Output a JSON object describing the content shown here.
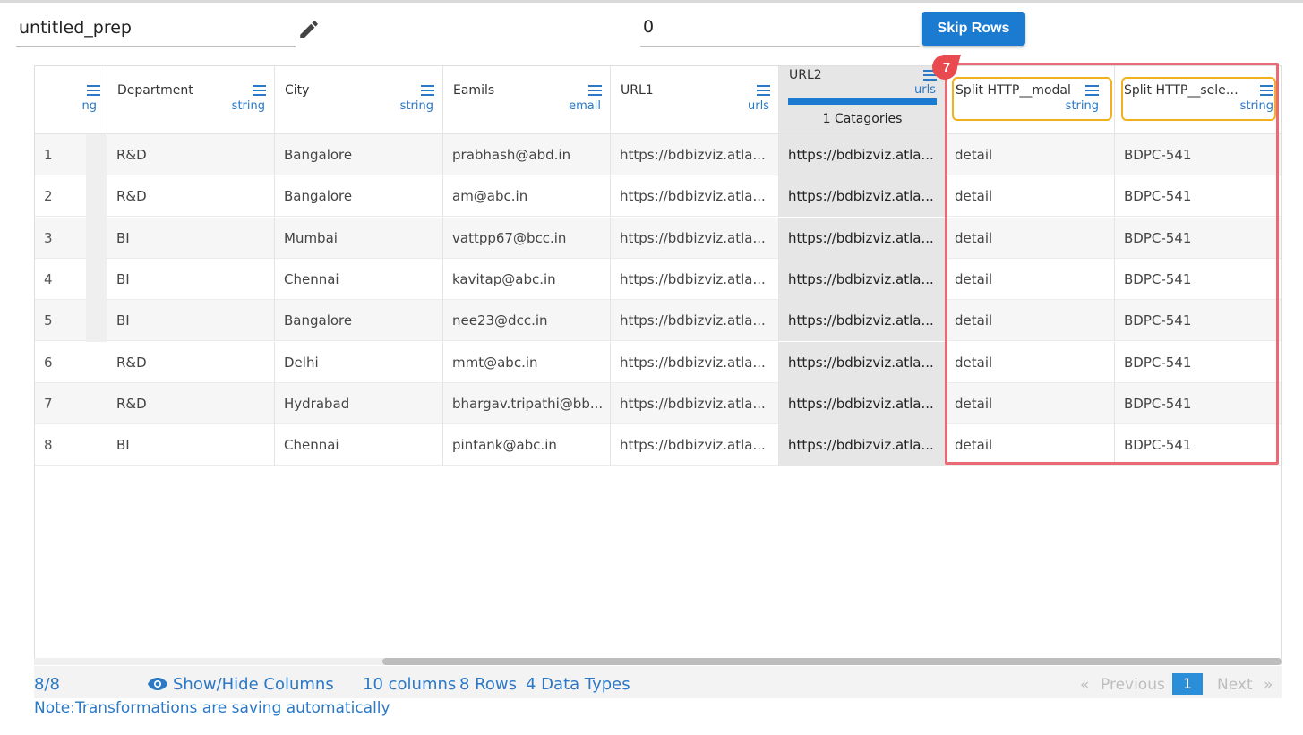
{
  "header": {
    "prep_name": "untitled_prep",
    "skip_value": "0",
    "skip_button_label": "Skip Rows"
  },
  "grid": {
    "partial_column": {
      "type": "ng"
    },
    "columns": [
      {
        "name": "Department",
        "type": "string"
      },
      {
        "name": "City",
        "type": "string"
      },
      {
        "name": "Eamils",
        "type": "email"
      },
      {
        "name": "URL1",
        "type": "urls"
      },
      {
        "name": "URL2",
        "type": "urls",
        "categories": "1 Catagories"
      },
      {
        "name": "Split HTTP__modal",
        "type": "string"
      },
      {
        "name": "Split HTTP__select...",
        "type": "string"
      }
    ],
    "rows": [
      [
        "1",
        "R&D",
        "Bangalore",
        "prabhash@abd.in",
        "https://bdbizviz.atla...",
        "https://bdbizviz.atla...",
        "detail",
        "BDPC-541"
      ],
      [
        "2",
        "R&D",
        "Bangalore",
        "am@abc.in",
        "https://bdbizviz.atla...",
        "https://bdbizviz.atla...",
        "detail",
        "BDPC-541"
      ],
      [
        "3",
        "BI",
        "Mumbai",
        "vattpp67@bcc.in",
        "https://bdbizviz.atla...",
        "https://bdbizviz.atla...",
        "detail",
        "BDPC-541"
      ],
      [
        "4",
        "BI",
        "Chennai",
        "kavitap@abc.in",
        "https://bdbizviz.atla...",
        "https://bdbizviz.atla...",
        "detail",
        "BDPC-541"
      ],
      [
        "5",
        "BI",
        "Bangalore",
        "nee23@dcc.in",
        "https://bdbizviz.atla...",
        "https://bdbizviz.atla...",
        "detail",
        "BDPC-541"
      ],
      [
        "6",
        "R&D",
        "Delhi",
        "mmt@abc.in",
        "https://bdbizviz.atla...",
        "https://bdbizviz.atla...",
        "detail",
        "BDPC-541"
      ],
      [
        "7",
        "R&D",
        "Hydrabad",
        "bhargav.tripathi@bb...",
        "https://bdbizviz.atla...",
        "https://bdbizviz.atla...",
        "detail",
        "BDPC-541"
      ],
      [
        "8",
        "BI",
        "Chennai",
        "pintank@abc.in",
        "https://bdbizviz.atla...",
        "https://bdbizviz.atla...",
        "detail",
        "BDPC-541"
      ]
    ]
  },
  "annotation": {
    "badge_number": "7",
    "box_color": "#ea6a73",
    "highlight_color": "#f2b01e"
  },
  "footer": {
    "row_count": "8/8",
    "show_hide_label": "Show/Hide Columns",
    "columns_count": "10 columns",
    "rows_count": "8 Rows",
    "data_types": "4 Data Types",
    "prev_arrow": "«",
    "prev_label": "Previous",
    "current_page": "1",
    "next_label": "Next",
    "next_arrow": "»",
    "note": "Note:Transformations are saving automatically"
  },
  "colors": {
    "accent": "#1a7bd1",
    "link": "#2a78c6"
  }
}
